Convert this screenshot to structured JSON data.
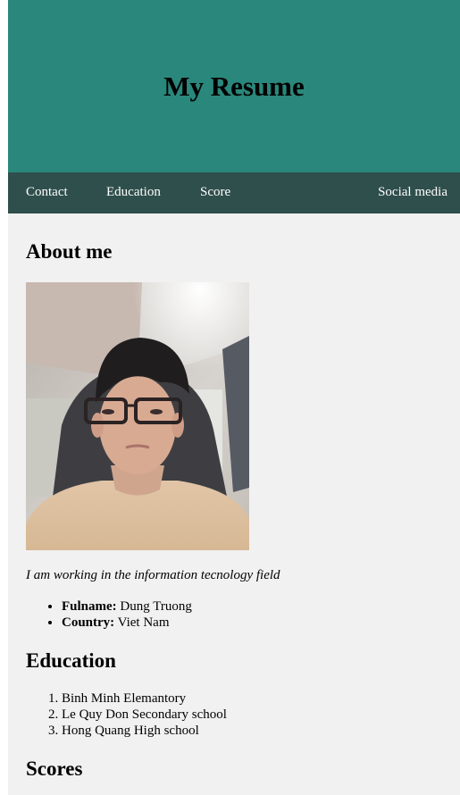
{
  "header": {
    "title": "My Resume"
  },
  "nav": {
    "contact": "Contact",
    "education": "Education",
    "score": "Score",
    "social": "Social media"
  },
  "about": {
    "heading": "About me",
    "photo_alt": "Profile photo",
    "tagline": "I am working in the information tecnology field",
    "fullname_label": "Fulname:",
    "fullname_value": " Dung Truong",
    "country_label": "Country:",
    "country_value": " Viet Nam"
  },
  "education": {
    "heading": "Education",
    "items": [
      "Binh Minh Elemantory",
      "Le Quy Don Secondary school",
      "Hong Quang High school"
    ]
  },
  "scores": {
    "heading": "Scores"
  },
  "colors": {
    "header_bg": "#2a877b",
    "nav_bg": "#2f4f4c",
    "page_bg": "#f1f1f1"
  }
}
